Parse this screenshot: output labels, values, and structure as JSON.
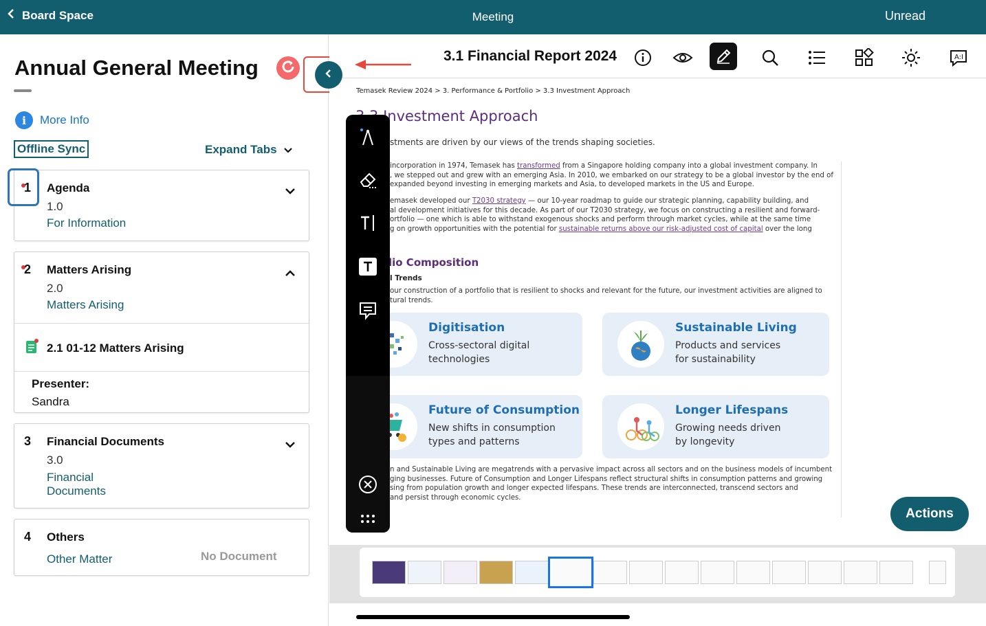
{
  "topbar": {
    "back_label": "Board Space",
    "center_label": "Meeting",
    "unread_label": "Unread"
  },
  "meeting": {
    "title": "Annual General Meeting",
    "more_info": "More Info",
    "offline_sync": "Offline Sync",
    "expand_tabs": "Expand Tabs"
  },
  "agenda": [
    {
      "num": "1",
      "title": "Agenda",
      "version": "1.0",
      "subtitle": "For Information"
    },
    {
      "num": "2",
      "title": "Matters Arising",
      "version": "2.0",
      "subtitle": "Matters Arising",
      "doc": "2.1 01-12 Matters Arising",
      "presenter_label": "Presenter:",
      "presenter": "Sandra"
    },
    {
      "num": "3",
      "title": "Financial Documents",
      "version": "3.0",
      "subtitle_line1": "Financial",
      "subtitle_line2": "Documents"
    },
    {
      "num": "4",
      "title": "Others",
      "subtitle": "Other Matter",
      "no_document": "No Document"
    }
  ],
  "document": {
    "title": "3.1 Financial Report 2024",
    "breadcrumb": "Temasek Review 2024 > 3. Performance & Portfolio > 3.3 Investment Approach",
    "section_title": "3.3 Investment Approach",
    "intro": "stments are driven by our views of the trends shaping societies.",
    "p1": [
      "incorporation in 1974, Temasek has ",
      "transformed",
      " from a Singapore holding company into a global investment company. In",
      ", we stepped out and grew with an emerging Asia. In 2010, we embarked on our strategy to be a global investor by the end of",
      "expanded beyond investing in emerging markets and Asia, to developed markets in the US and Europe."
    ],
    "p2": [
      "emasek developed our ",
      "T2030 strategy",
      " — our 10-year roadmap to guide our strategic planning, capability building, and",
      "al development initiatives for this decade. As part of our T2030 strategy, we focus on constructing a resilient and forward-",
      "ortfolio — one which is able to withstand exogenous shocks and perform through market cycles, while at the same time",
      "g on growth opportunities with the potential for ",
      "sustainable returns above our risk-adjusted cost of capital",
      " over the long"
    ],
    "portfolio_title": "lio Composition",
    "portfolio_sub": "l Trends",
    "portfolio_text": [
      "our construction of a portfolio that is resilient to shocks and relevant for the future, our investment activities are aligned to",
      "tural trends."
    ],
    "trends": [
      {
        "title": "Digitisation",
        "line1": "Cross-sectoral digital",
        "line2": "technologies"
      },
      {
        "title": "Sustainable Living",
        "line1": "Products and services",
        "line2": "for sustainability"
      },
      {
        "title": "Future of Consumption",
        "line1": "New shifts in consumption",
        "line2": "types and patterns"
      },
      {
        "title": "Longer Lifespans",
        "line1": "Growing needs driven",
        "line2": "by longevity"
      }
    ],
    "closing": [
      "n and Sustainable Living are megatrends with a pervasive impact across all sectors and on the business models of incumbent",
      "ging businesses. Future of Consumption and Longer Lifespans reflect structural shifts in consumption patterns and growing",
      "sing from population growth and longer expected lifespans. These trends are interconnected, transcend sectors and",
      " and persist through economic cycles."
    ]
  },
  "actions_label": "Actions",
  "toolbar_icons": [
    "info-icon",
    "eye-icon",
    "pen-icon",
    "search-icon",
    "list-icon",
    "grid-icon",
    "brightness-icon",
    "ai-translate-icon"
  ],
  "annotation_tools": [
    "pen-tool-icon",
    "eraser-icon",
    "text-cursor-icon",
    "text-box-icon",
    "comment-icon",
    "close-icon",
    "more-icon"
  ],
  "thumbnails": {
    "count": 16,
    "selected_index": 5
  },
  "colors": {
    "brand": "#135e6e",
    "accent_red": "#e8473c",
    "link_blue": "#1a73c8",
    "section_purple": "#5b2d7f"
  }
}
